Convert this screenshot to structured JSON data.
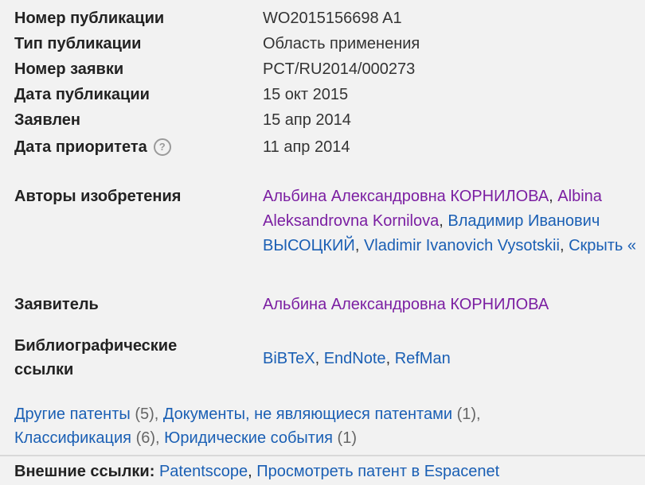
{
  "meta": {
    "rows": [
      {
        "label": "Номер публикации",
        "value": "WO2015156698 A1"
      },
      {
        "label": "Тип публикации",
        "value": "Область применения"
      },
      {
        "label": "Номер заявки",
        "value": "PCT/RU2014/000273"
      },
      {
        "label": "Дата публикации",
        "value": "15 окт 2015"
      },
      {
        "label": "Заявлен",
        "value": "15 апр 2014"
      },
      {
        "label": "Дата приоритета",
        "value": "11 апр 2014"
      }
    ],
    "help_glyph": "?"
  },
  "inventors": {
    "label": "Авторы изобретения",
    "links": [
      {
        "text": "Альбина Александровна КОРНИЛОВА",
        "sep": ","
      },
      {
        "text": "Albina Aleksandrovna Kornilova",
        "sep": ","
      },
      {
        "text": "Владимир Иванович ВЫСОЦКИЙ",
        "sep": ","
      },
      {
        "text": "Vladimir Ivanovich Vysotskii",
        "sep": ","
      },
      {
        "text": "Скрыть «",
        "sep": ""
      }
    ]
  },
  "applicant": {
    "label": "Заявитель",
    "value": "Альбина Александровна КОРНИЛОВА"
  },
  "bibliography": {
    "label_line1": "Библиографические",
    "label_line2": "ссылки",
    "links": [
      {
        "text": "BiBTeX",
        "sep": ","
      },
      {
        "text": "EndNote",
        "sep": ","
      },
      {
        "text": "RefMan",
        "sep": ""
      }
    ]
  },
  "sections": {
    "other_patents": "Другие патенты",
    "other_patents_count": "(5),",
    "non_patent_docs": "Документы, не являющиеся патентами",
    "non_patent_docs_count": "(1),",
    "classification": "Классификация",
    "classification_count": "(6),",
    "legal_events": "Юридические события",
    "legal_events_count": "(1)"
  },
  "external": {
    "label": "Внешние ссылки:",
    "patentscope": "Patentscope",
    "espacenet": "Просмотреть патент в Espacenet"
  },
  "colors": {
    "visited_link": "#7b1fa2",
    "link": "#1a5fb4",
    "background": "#f2f2f2"
  }
}
